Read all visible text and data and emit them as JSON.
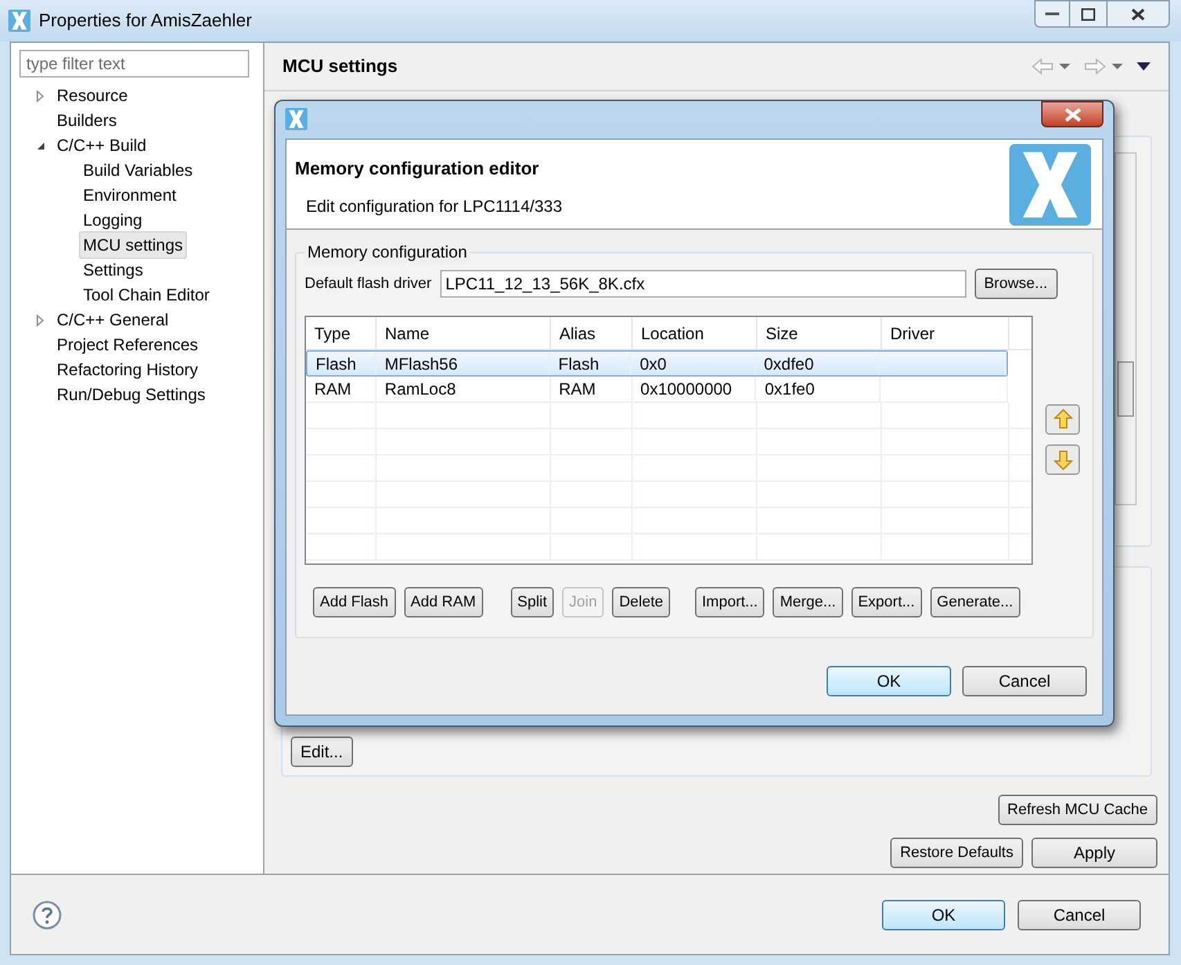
{
  "window": {
    "title": "Properties for AmisZaehler"
  },
  "filter": {
    "placeholder": "type filter text"
  },
  "tree": [
    {
      "label": "Resource",
      "expanded": false,
      "selected": false
    },
    {
      "label": "Builders",
      "selected": false
    },
    {
      "label": "C/C++ Build",
      "expanded": true,
      "selected": false,
      "children": [
        {
          "label": "Build Variables",
          "selected": false
        },
        {
          "label": "Environment",
          "selected": false
        },
        {
          "label": "Logging",
          "selected": false
        },
        {
          "label": "MCU settings",
          "selected": true
        },
        {
          "label": "Settings",
          "selected": false
        },
        {
          "label": "Tool Chain Editor",
          "selected": false
        }
      ]
    },
    {
      "label": "C/C++ General",
      "expanded": false,
      "selected": false
    },
    {
      "label": "Project References",
      "selected": false
    },
    {
      "label": "Refactoring History",
      "selected": false
    },
    {
      "label": "Run/Debug Settings",
      "selected": false
    }
  ],
  "page": {
    "title": "MCU settings",
    "edit_button": "Edit...",
    "refresh_button": "Refresh MCU Cache",
    "restore_button": "Restore Defaults",
    "apply_button": "Apply"
  },
  "footer": {
    "buttons": [
      {
        "label": "OK",
        "default": true
      },
      {
        "label": "Cancel",
        "default": false
      }
    ]
  },
  "dialog": {
    "heading": "Memory configuration editor",
    "subtitle": "Edit configuration for LPC1114/333",
    "group": "Memory configuration",
    "flash_driver_label": "Default flash driver",
    "flash_driver_value": "LPC11_12_13_56K_8K.cfx",
    "browse_button": "Browse...",
    "columns": [
      "Type",
      "Name",
      "Alias",
      "Location",
      "Size",
      "Driver"
    ],
    "rows": [
      {
        "cells": [
          "Flash",
          "MFlash56",
          "Flash",
          "0x0",
          "0xdfe0",
          ""
        ],
        "selected": true
      },
      {
        "cells": [
          "RAM",
          "RamLoc8",
          "RAM",
          "0x10000000",
          "0x1fe0",
          ""
        ],
        "selected": false
      }
    ],
    "actions": [
      {
        "label": "Add Flash",
        "disabled": false
      },
      {
        "label": "Add RAM",
        "disabled": false
      },
      {
        "label": "Split",
        "disabled": false
      },
      {
        "label": "Join",
        "disabled": true
      },
      {
        "label": "Delete",
        "disabled": false
      },
      {
        "label": "Import...",
        "disabled": false
      },
      {
        "label": "Merge...",
        "disabled": false
      },
      {
        "label": "Export...",
        "disabled": false
      },
      {
        "label": "Generate...",
        "disabled": false
      }
    ],
    "buttons": [
      {
        "label": "OK",
        "default": true
      },
      {
        "label": "Cancel",
        "default": false
      }
    ]
  }
}
